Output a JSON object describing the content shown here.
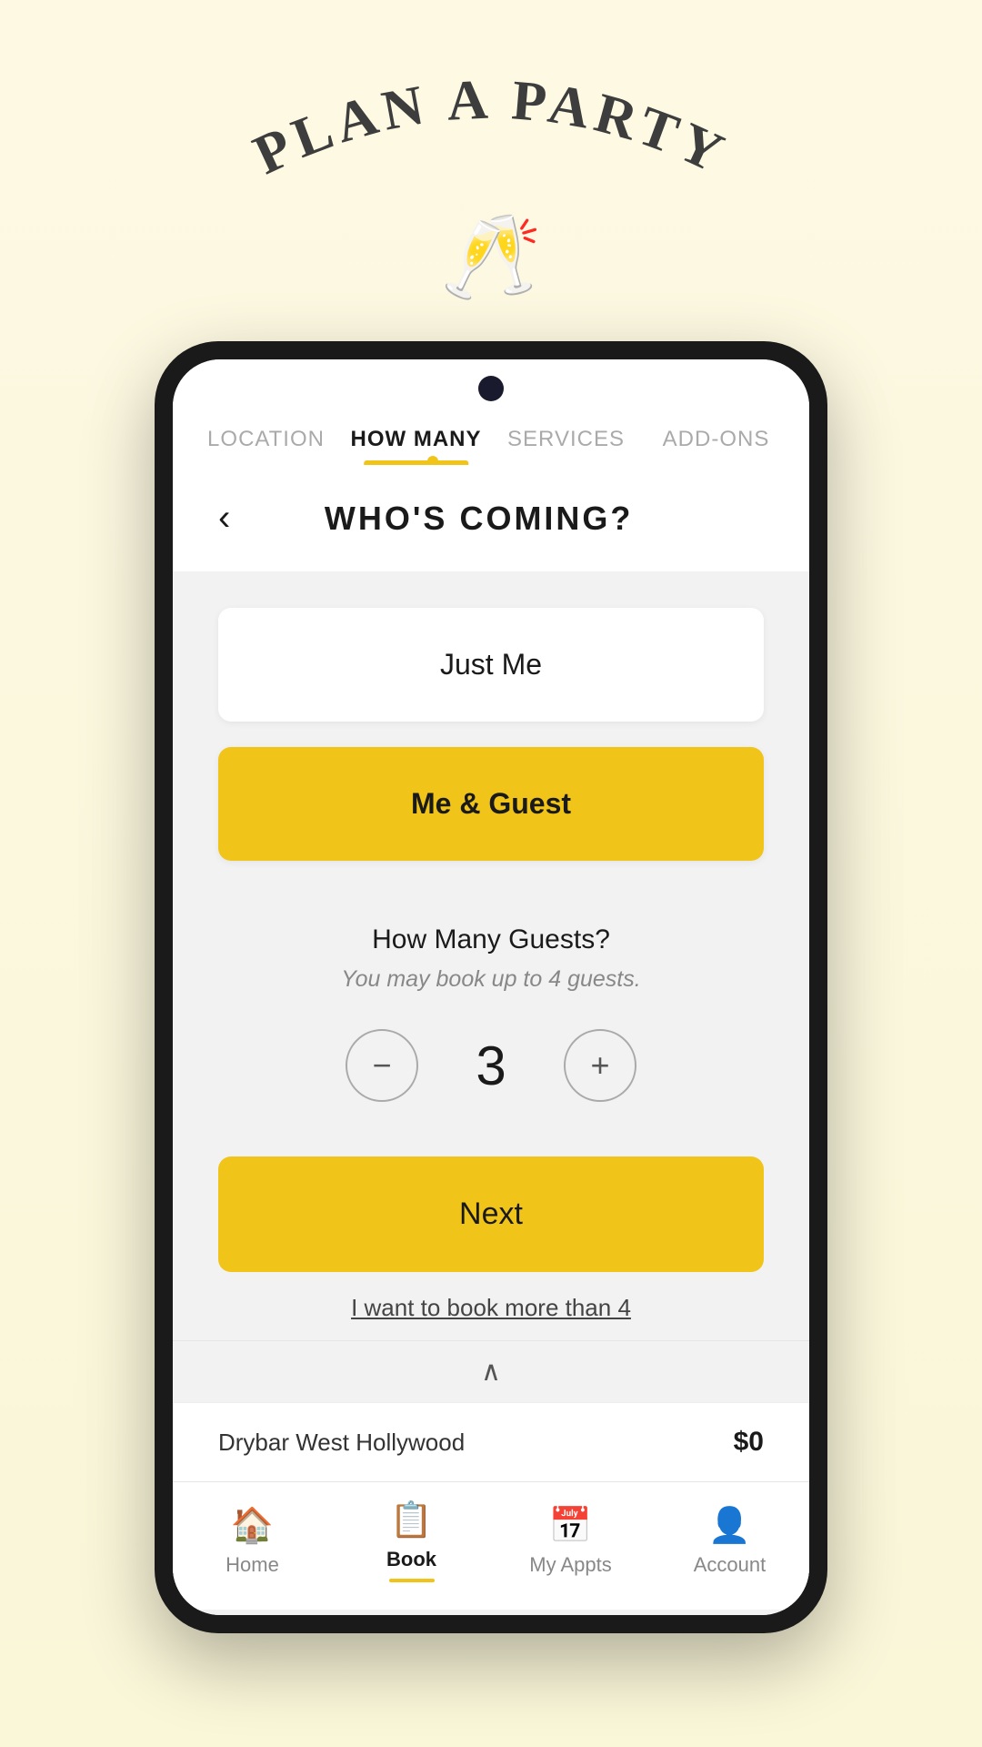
{
  "header": {
    "title_arch": "PLAN A PARTY",
    "champagne_emoji": "🥂"
  },
  "tabs": [
    {
      "id": "location",
      "label": "LOCATION",
      "active": false
    },
    {
      "id": "how-many",
      "label": "HOW MANY",
      "active": true
    },
    {
      "id": "services",
      "label": "SERVICES",
      "active": false
    },
    {
      "id": "add-ons",
      "label": "ADD-ONS",
      "active": false
    }
  ],
  "page": {
    "back_label": "‹",
    "title": "WHO'S COMING?"
  },
  "options": [
    {
      "id": "just-me",
      "label": "Just Me",
      "selected": false
    },
    {
      "id": "me-guest",
      "label": "Me & Guest",
      "selected": true
    }
  ],
  "guests": {
    "title": "How Many Guests?",
    "subtitle": "You may book up to 4 guests.",
    "count": "3",
    "decrement_label": "−",
    "increment_label": "+"
  },
  "next_button": {
    "label": "Next"
  },
  "book_more": {
    "label": "I want to book more than 4"
  },
  "summary_bar": {
    "chevron": "∧",
    "location": "Drybar West Hollywood",
    "price": "$0"
  },
  "bottom_nav": [
    {
      "id": "home",
      "label": "Home",
      "icon": "🏠",
      "active": false
    },
    {
      "id": "book",
      "label": "Book",
      "icon": "📋",
      "active": true
    },
    {
      "id": "my-appts",
      "label": "My Appts",
      "icon": "📅",
      "active": false
    },
    {
      "id": "account",
      "label": "Account",
      "icon": "👤",
      "active": false
    }
  ],
  "colors": {
    "accent": "#f0c419",
    "bg": "#fdf9e3",
    "dark": "#1a1a1a"
  }
}
